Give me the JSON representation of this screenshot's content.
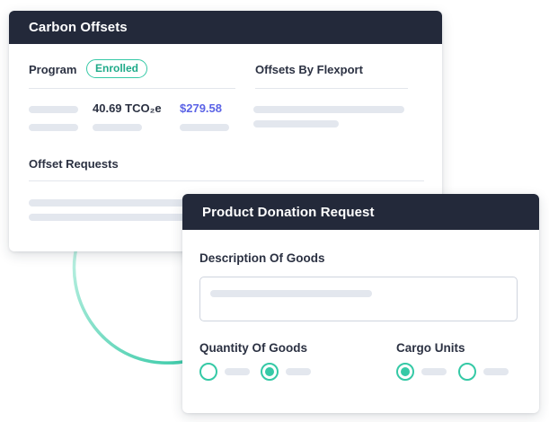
{
  "carbon_offsets": {
    "title": "Carbon Offsets",
    "program_label": "Program",
    "program_status": "Enrolled",
    "offsets_by_flexport_label": "Offsets By Flexport",
    "emissions_value": "40.69 TCO₂e",
    "cost_value": "$279.58",
    "offset_requests_label": "Offset Requests"
  },
  "product_donation": {
    "title": "Product Donation Request",
    "description_label": "Description Of Goods",
    "quantity_label": "Quantity Of Goods",
    "quantity_options": [
      {
        "checked": false
      },
      {
        "checked": true
      }
    ],
    "cargo_label": "Cargo Units",
    "cargo_options": [
      {
        "checked": true
      },
      {
        "checked": false
      }
    ]
  },
  "colors": {
    "header_bg": "#23293a",
    "accent_teal": "#35c9a6",
    "money_blue": "#5b63e6",
    "skeleton": "#e3e7ee"
  }
}
